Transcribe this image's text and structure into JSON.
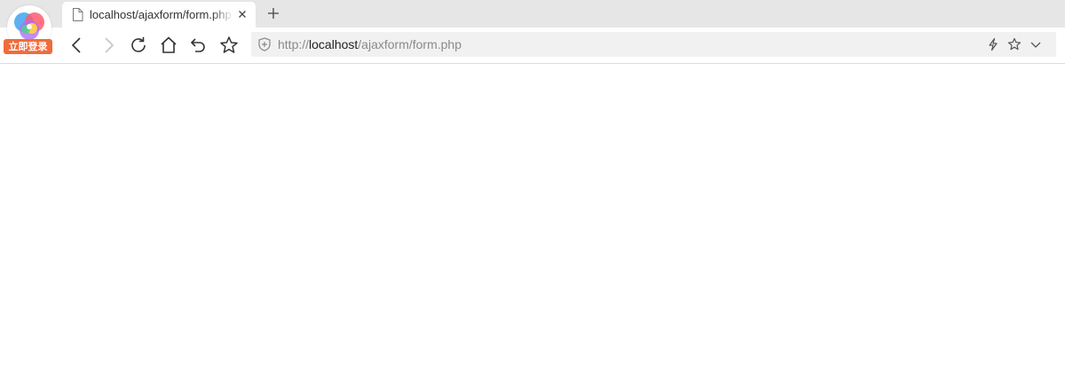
{
  "browser": {
    "login_badge": "立即登录",
    "tab": {
      "title": "localhost/ajaxform/form.php",
      "icon": "page-icon"
    },
    "address": {
      "scheme": "http://",
      "host": "localhost",
      "path": "/ajaxform/form.php"
    },
    "toolbar_icons": [
      "back-icon",
      "forward-icon",
      "reload-icon",
      "home-icon",
      "undo-close-tab-icon",
      "favorite-star-icon"
    ],
    "address_icons": [
      "shield-icon",
      "lightning-icon",
      "bookmark-star-icon",
      "chevron-down-icon"
    ],
    "colors": {
      "tab_strip": "#e6e6e6",
      "address_bar": "#f1f1f1",
      "login_badge": "#f26b3a",
      "url_dim": "#8a8a8a",
      "url_host": "#222222"
    }
  },
  "page": {
    "content": ""
  }
}
